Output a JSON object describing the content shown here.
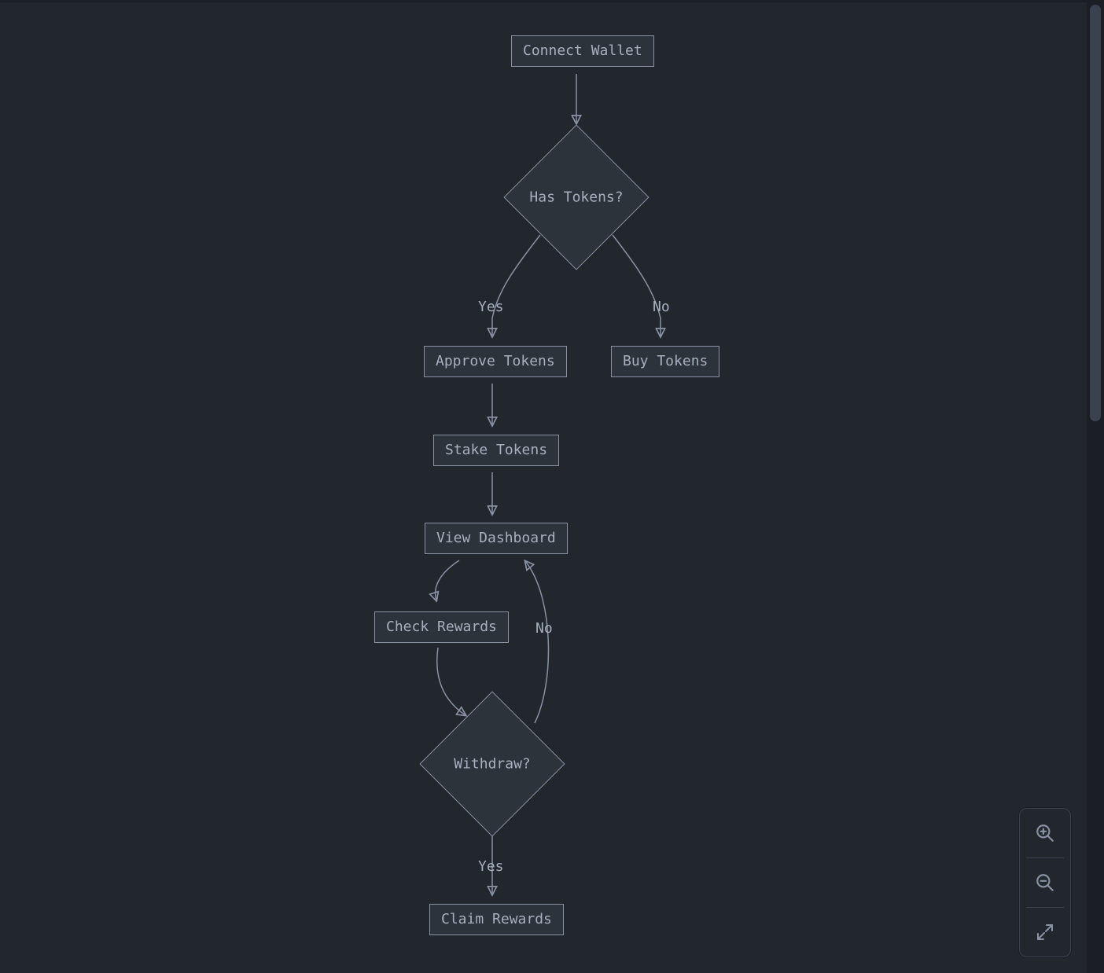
{
  "nodes": {
    "connect_wallet": "Connect Wallet",
    "has_tokens": "Has Tokens?",
    "approve_tokens": "Approve Tokens",
    "buy_tokens": "Buy Tokens",
    "stake_tokens": "Stake Tokens",
    "view_dashboard": "View Dashboard",
    "check_rewards": "Check Rewards",
    "withdraw": "Withdraw?",
    "claim_rewards": "Claim Rewards"
  },
  "edges": {
    "has_tokens_yes": "Yes",
    "has_tokens_no": "No",
    "withdraw_no": "No",
    "withdraw_yes": "Yes"
  },
  "controls": {
    "zoom_in": "zoom-in",
    "zoom_out": "zoom-out",
    "fullscreen": "fullscreen"
  },
  "colors": {
    "bg": "#22272e",
    "node_fill": "#2d333b",
    "stroke": "#8892a3",
    "text": "#a6b0bf",
    "panel_border": "#3a4250"
  }
}
